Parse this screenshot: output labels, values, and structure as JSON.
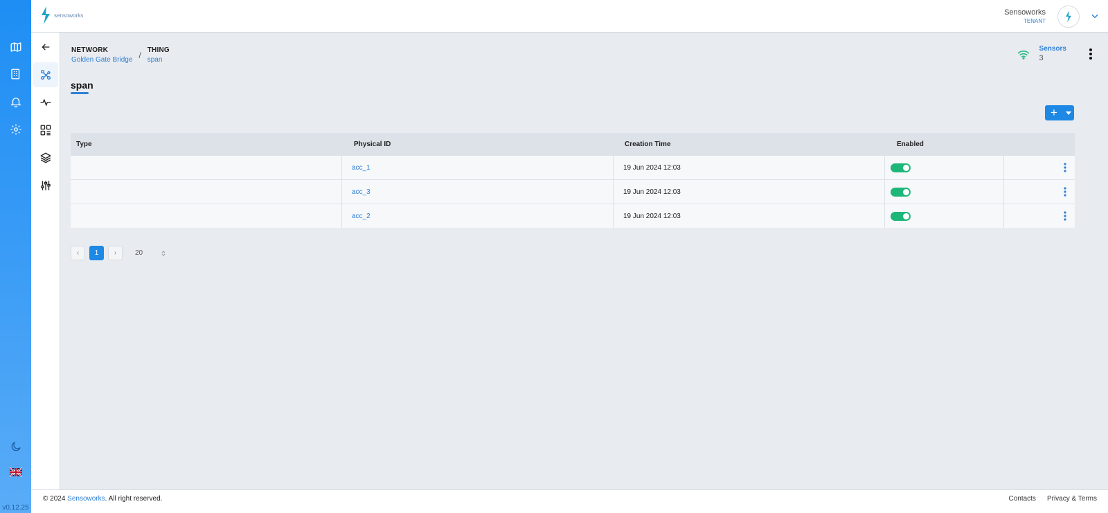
{
  "header": {
    "logo_text": "sensoworks",
    "user_name": "Sensoworks",
    "user_role": "TENANT"
  },
  "rail": {
    "version": "v0.12.25"
  },
  "breadcrumb": {
    "network_label": "NETWORK",
    "network_value": "Golden Gate Bridge",
    "separator": "/",
    "thing_label": "THING",
    "thing_value": "span"
  },
  "sensors": {
    "label": "Sensors",
    "count": "3"
  },
  "page": {
    "title": "span",
    "add_label": "+"
  },
  "table": {
    "columns": [
      "Type",
      "Physical ID",
      "Creation Time",
      "Enabled"
    ],
    "rows": [
      {
        "type": "",
        "physical_id": "acc_1",
        "creation_time": "19 Jun 2024 12:03",
        "enabled": true
      },
      {
        "type": "",
        "physical_id": "acc_3",
        "creation_time": "19 Jun 2024 12:03",
        "enabled": true
      },
      {
        "type": "",
        "physical_id": "acc_2",
        "creation_time": "19 Jun 2024 12:03",
        "enabled": true
      }
    ]
  },
  "pagination": {
    "prev": "‹",
    "current": "1",
    "next": "›",
    "page_size": "20"
  },
  "footer": {
    "copyright_prefix": "© 2024 ",
    "copyright_brand": "Sensoworks",
    "copyright_suffix": ". All right reserved.",
    "contacts": "Contacts",
    "privacy": "Privacy & Terms"
  },
  "colors": {
    "primary": "#1e88e5",
    "rail_top": "#1e8ef4",
    "toggle_on": "#1fb67a",
    "wifi": "#1fb67a"
  },
  "icons": {
    "rail": [
      "map-icon",
      "building-icon",
      "bell-icon",
      "gear-icon",
      "moon-icon",
      "uk-flag-icon"
    ],
    "subnav": [
      "back-arrow-icon",
      "network-nodes-icon",
      "activity-icon",
      "widgets-icon",
      "layers-icon",
      "sliders-icon"
    ]
  }
}
